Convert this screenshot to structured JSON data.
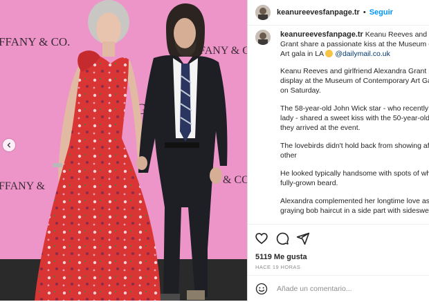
{
  "post": {
    "username": "keanureevesfanpage.tr",
    "separator": "•",
    "follow_label": "Seguir",
    "caption": {
      "line1": "Keanu Reeves and girlfriend Alexandra",
      "line2": "Grant share a passionate kiss at the Museum of",
      "line3": "Art gala in LA",
      "link": "@dailymail.co.uk",
      "p1": [
        "Keanu Reeves and girlfriend Alexandra Grant put",
        "display at the Museum of Contemporary Art Gala",
        "on Saturday."
      ],
      "p2": [
        "The 58-year-old John Wick star - who recently g",
        "lady - shared a sweet kiss with the 50-year-old",
        "they arrived at the event."
      ],
      "p3": [
        "The lovebirds didn't hold back from showing af",
        "other"
      ],
      "p4": [
        "He looked typically handsome with spots of wh",
        "fully-grown beard."
      ],
      "p5": [
        "Alexandra complemented her longtime love as",
        "graying bob haircut in a side part with sideswep"
      ]
    },
    "likes": "5119 Me gusta",
    "time": "HACE 19 HORAS",
    "comment_placeholder": "Añade un comentario..."
  },
  "photo": {
    "backdrop_text_left": "FFANY & CO.",
    "backdrop_text_right": "FANY & C",
    "backdrop_text_left2": "FFANY &",
    "backdrop_text_right2": "& CO"
  },
  "icons": {
    "like": "heart-icon",
    "comment": "comment-icon",
    "share": "share-icon",
    "prev": "chevron-left-icon",
    "emoji": "smile-icon"
  },
  "colors": {
    "backdrop": "#e98fc2",
    "dress": "#d83a3a",
    "follow": "#0095f6",
    "link": "#00376b"
  }
}
